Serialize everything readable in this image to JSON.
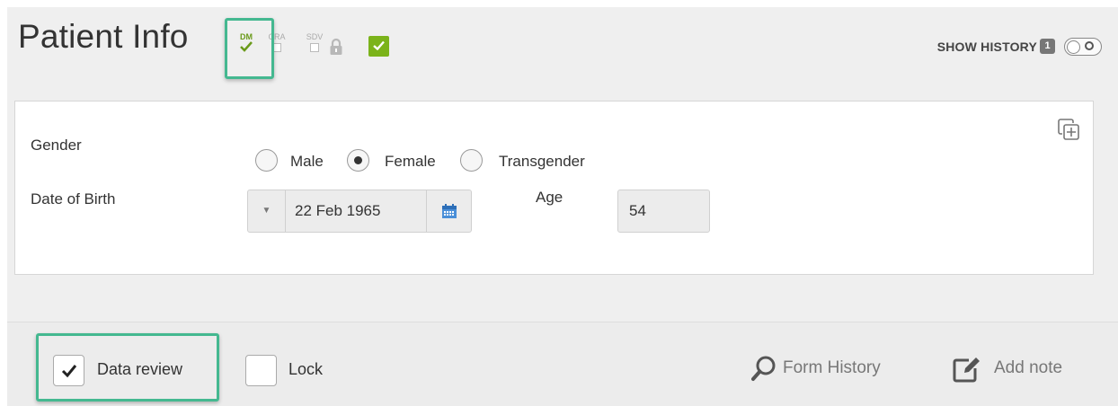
{
  "header": {
    "title": "Patient Info",
    "flags": {
      "dm": "DM",
      "cra": "CRA",
      "sdv": "SDV"
    },
    "show_history_label": "SHOW HISTORY",
    "history_count": "1"
  },
  "form": {
    "gender_label": "Gender",
    "gender_options": [
      "Male",
      "Female",
      "Transgender"
    ],
    "gender_selected": "Female",
    "dob_label": "Date of Birth",
    "dob_value": "22 Feb 1965",
    "age_label": "Age",
    "age_value": "54"
  },
  "footer": {
    "data_review_label": "Data review",
    "data_review_checked": true,
    "lock_label": "Lock",
    "lock_checked": false,
    "form_history_label": "Form History",
    "add_note_label": "Add note"
  },
  "colors": {
    "highlight": "#44b890",
    "approved": "#7bb31a",
    "dm_flag": "#6a9a1a"
  },
  "icons": {
    "dm_flag": "dm-check-icon",
    "lock": "padlock-icon",
    "approved": "approved-check-icon",
    "copy": "copy-add-icon",
    "calendar": "calendar-icon",
    "form_history": "search-icon",
    "add_note": "edit-note-icon"
  }
}
